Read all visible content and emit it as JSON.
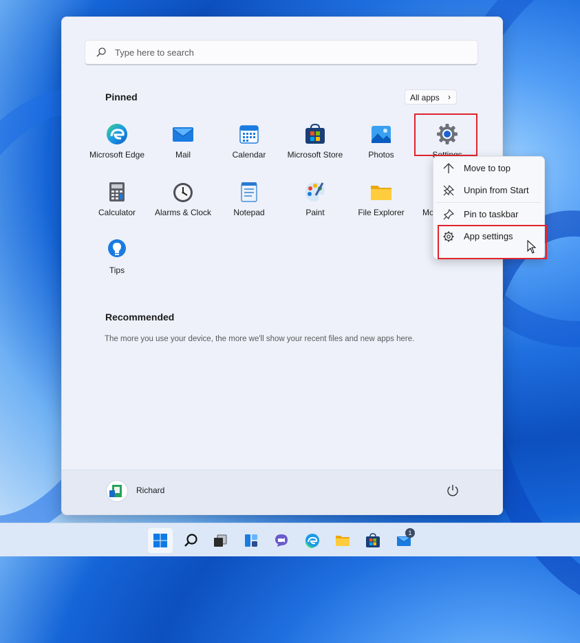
{
  "search": {
    "placeholder": "Type here to search"
  },
  "pinned": {
    "title": "Pinned",
    "all_apps_label": "All apps",
    "apps": [
      {
        "label": "Microsoft Edge",
        "icon": "edge-icon"
      },
      {
        "label": "Mail",
        "icon": "mail-icon"
      },
      {
        "label": "Calendar",
        "icon": "calendar-icon"
      },
      {
        "label": "Microsoft Store",
        "icon": "store-icon"
      },
      {
        "label": "Photos",
        "icon": "photos-icon"
      },
      {
        "label": "Settings",
        "icon": "gear-icon"
      },
      {
        "label": "Calculator",
        "icon": "calculator-icon"
      },
      {
        "label": "Alarms & Clock",
        "icon": "clock-icon"
      },
      {
        "label": "Notepad",
        "icon": "notepad-icon"
      },
      {
        "label": "Paint",
        "icon": "paint-icon"
      },
      {
        "label": "File Explorer",
        "icon": "folder-icon"
      },
      {
        "label": "Mo",
        "icon": "movies-icon"
      },
      {
        "label": "Tips",
        "icon": "lightbulb-icon"
      }
    ]
  },
  "recommended": {
    "title": "Recommended",
    "empty_text": "The more you use your device, the more we'll show your recent files and new apps here."
  },
  "user": {
    "name": "Richard"
  },
  "context_menu": {
    "items": [
      {
        "label": "Move to top",
        "icon": "arrow-up-icon"
      },
      {
        "label": "Unpin from Start",
        "icon": "unpin-icon"
      },
      {
        "label": "Pin to taskbar",
        "icon": "pin-icon"
      },
      {
        "label": "App settings",
        "icon": "gear-icon"
      }
    ]
  },
  "taskbar": {
    "items": [
      "start-icon",
      "search-icon",
      "task-view-icon",
      "widgets-icon",
      "chat-icon",
      "edge-icon",
      "folder-icon",
      "store-icon",
      "mail-icon"
    ],
    "mail_badge": "1"
  },
  "colors": {
    "highlight": "#e0232e",
    "accent": "#0067c0"
  }
}
